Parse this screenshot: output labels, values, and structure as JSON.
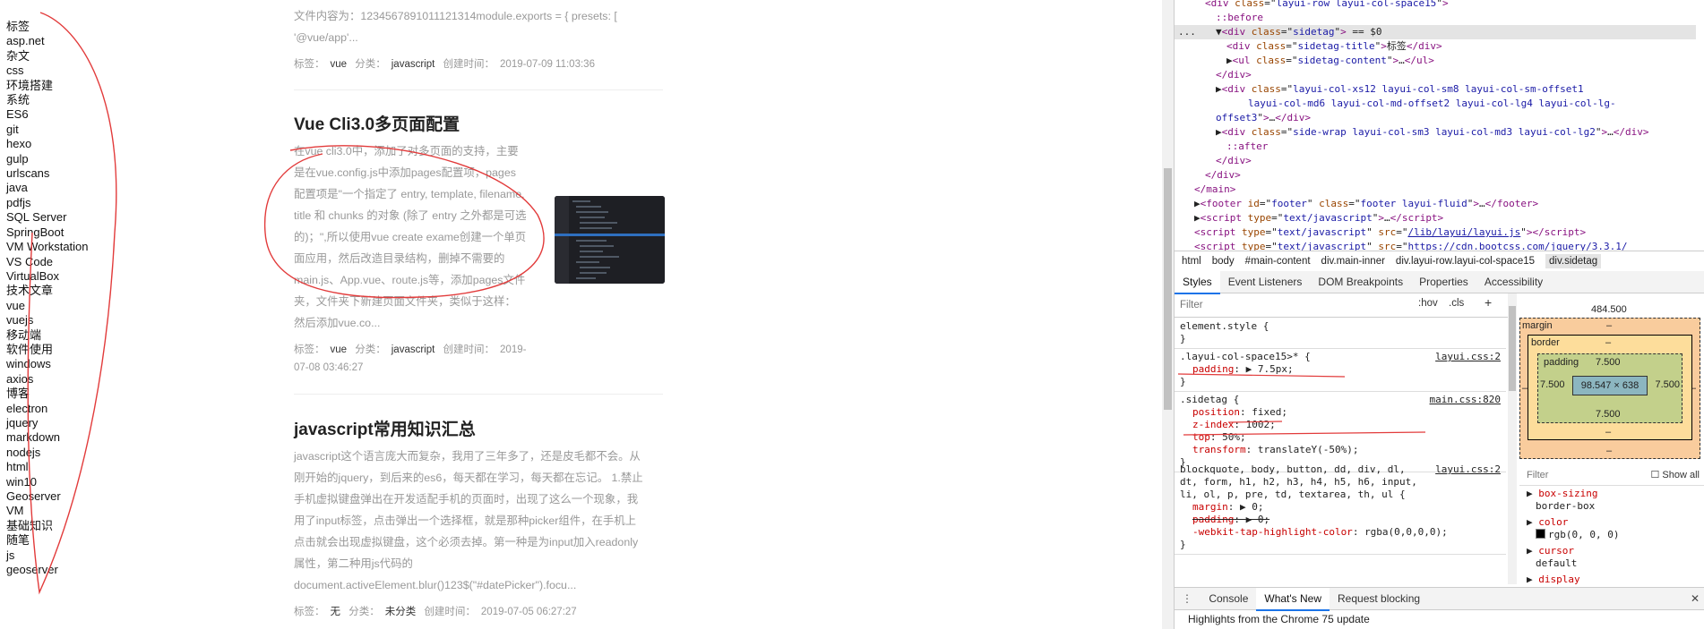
{
  "sidetag": {
    "title": "标签",
    "tags": [
      "asp.net",
      "杂文",
      "css",
      "环境搭建",
      "系统",
      "ES6",
      "git",
      "hexo",
      "gulp",
      "urlscans",
      "java",
      "pdfjs",
      "SQL Server",
      "SpringBoot",
      "VM Workstation",
      "VS Code",
      "VirtualBox",
      "技术文章",
      "vue",
      "vuejs",
      "移动端",
      "软件使用",
      "windows",
      "axios",
      "博客",
      "electron",
      "jquery",
      "markdown",
      "nodejs",
      "html",
      "win10",
      "Geoserver",
      "VM",
      "基础知识",
      "随笔",
      "js",
      "geoserver"
    ]
  },
  "articles": [
    {
      "title": "",
      "lines": [
        "文件内容为：1234567891011121314module.exports = { presets: [",
        "'@vue/app'..."
      ],
      "tag_label": "标签：",
      "tag": "vue",
      "cat_label": "分类：",
      "category": "javascript",
      "time_label": "创建时间：",
      "time": "2019-07-09 11:03:36"
    },
    {
      "title": "Vue Cli3.0多页面配置",
      "lines": [
        "在vue cli3.0中，添加了对多页面的支持，主要",
        "是在vue.config.js中添加pages配置项，pages",
        "配置项是\"一个指定了 entry, template, filename,",
        "title 和 chunks 的对象 (除了 entry 之外都是可选",
        "的)；\",所以使用vue create exame创建一个单页",
        "面应用，然后改造目录结构，删掉不需要的",
        "main.js、App.vue、route.js等，添加pages文件",
        "夹，文件夹下新建页面文件夹，类似于这样：",
        "然后添加vue.co..."
      ],
      "tag_label": "标签：",
      "tag": "vue",
      "cat_label": "分类：",
      "category": "javascript",
      "time_label": "创建时间：",
      "time": "2019-",
      "time2": "07-08 03:46:27"
    },
    {
      "title": "javascript常用知识汇总",
      "lines": [
        "javascript这个语言庞大而复杂，我用了三年多了，还是皮毛都不会。从",
        "刚开始的jquery，到后来的es6，每天都在学习，每天都在忘记。 1.禁止",
        "手机虚拟键盘弹出在开发适配手机的页面时，出现了这么一个现象，我",
        "用了input标签，点击弹出一个选择框，就是那种picker组件，在手机上",
        "点击就会出现虚拟键盘，这个必须去掉。第一种是为input加入readonly",
        "属性，第二种用js代码的",
        "document.activeElement.blur()123$(\"#datePicker\").focu..."
      ],
      "tag_label": "标签：",
      "tag": "无",
      "cat_label": "分类：",
      "category": "未分类",
      "time_label": "创建时间：",
      "time": "2019-07-05 06:27:27"
    }
  ],
  "devtools": {
    "dom": [
      {
        "indent": 0,
        "html": "<span class='tagc'>&lt;div</span> <span class='attr'>class</span>=\"<span class='aval'>layui-row layui-col-space15</span>\"<span class='tagc'>&gt;</span>"
      },
      {
        "indent": 1,
        "html": "<span class='pseudo'>::before</span>"
      },
      {
        "indent": 1,
        "html": "▼<span class='tagc'>&lt;div</span> <span class='attr'>class</span>=\"<span class='aval'>sidetag</span>\"<span class='tagc'>&gt;</span> == $0"
      },
      {
        "indent": 2,
        "html": "<span class='tagc'>&lt;div</span> <span class='attr'>class</span>=\"<span class='aval'>sidetag-title</span>\"<span class='tagc'>&gt;</span>标签<span class='tagc'>&lt;/div&gt;</span>"
      },
      {
        "indent": 2,
        "html": "▶<span class='tagc'>&lt;ul</span> <span class='attr'>class</span>=\"<span class='aval'>sidetag-content</span>\"<span class='tagc'>&gt;</span>…<span class='tagc'>&lt;/ul&gt;</span>"
      },
      {
        "indent": 1,
        "html": "<span class='tagc'>&lt;/div&gt;</span>"
      },
      {
        "indent": 1,
        "html": "▶<span class='tagc'>&lt;div</span> <span class='attr'>class</span>=\"<span class='aval'>layui-col-xs12 layui-col-sm8 layui-col-sm-offset1</span>"
      },
      {
        "indent": 4,
        "html": "<span class='aval'>layui-col-md6 layui-col-md-offset2 layui-col-lg4 layui-col-lg-</span>"
      },
      {
        "indent": 1,
        "html": "<span class='aval'>offset3</span>\"<span class='tagc'>&gt;</span>…<span class='tagc'>&lt;/div&gt;</span>"
      },
      {
        "indent": 1,
        "html": "▶<span class='tagc'>&lt;div</span> <span class='attr'>class</span>=\"<span class='aval'>side-wrap layui-col-sm3 layui-col-md3 layui-col-lg2</span>\"<span class='tagc'>&gt;</span>…<span class='tagc'>&lt;/div&gt;</span>"
      },
      {
        "indent": 2,
        "html": "<span class='pseudo'>::after</span>"
      },
      {
        "indent": 1,
        "html": "<span class='tagc'>&lt;/div&gt;</span>"
      },
      {
        "indent": 0,
        "html": "<span class='tagc'>&lt;/div&gt;</span>"
      },
      {
        "indent": -1,
        "html": "<span class='tagc'>&lt;/main&gt;</span>"
      },
      {
        "indent": -1,
        "html": "▶<span class='tagc'>&lt;footer</span> <span class='attr'>id</span>=\"<span class='aval'>footer</span>\" <span class='attr'>class</span>=\"<span class='aval'>footer layui-fluid</span>\"<span class='tagc'>&gt;</span>…<span class='tagc'>&lt;/footer&gt;</span>"
      },
      {
        "indent": -1,
        "html": "▶<span class='tagc'>&lt;script</span> <span class='attr'>type</span>=\"<span class='aval'>text/javascript</span>\"<span class='tagc'>&gt;</span>…<span class='tagc'>&lt;/script&gt;</span>"
      },
      {
        "indent": -1,
        "html": "<span class='tagc'>&lt;script</span> <span class='attr'>type</span>=\"<span class='aval'>text/javascript</span>\" <span class='attr'>src</span>=\"<span class='aval' style='text-decoration:underline'>/lib/layui/layui.js</span>\"<span class='tagc'>&gt;&lt;/script&gt;</span>"
      },
      {
        "indent": -1,
        "html": "<span class='tagc'>&lt;script</span> <span class='attr'>type</span>=\"<span class='aval'>text/javascript</span>\" <span class='attr'>src</span>=\"<span class='aval' style='text-decoration:underline'>https://cdn.bootcss.com/jquery/3.3.1/</span>"
      }
    ],
    "breadcrumb": [
      "html",
      "body",
      "#main-content",
      "div.main-inner",
      "div.layui-row.layui-col-space15",
      "div.sidetag"
    ],
    "tabs": [
      "Styles",
      "Event Listeners",
      "DOM Breakpoints",
      "Properties",
      "Accessibility"
    ],
    "filter_placeholder": "Filter",
    "hov": ":hov",
    "cls": ".cls",
    "plus": "+",
    "rules": [
      {
        "selector": "element.style {",
        "src": "",
        "props": [],
        "close": "}"
      },
      {
        "selector": ".layui-col-space15>* {",
        "src": "layui.css:2",
        "props": [
          {
            "name": "padding",
            "value": "▶ 7.5px;",
            "struck": false
          }
        ],
        "close": "}"
      },
      {
        "selector": ".sidetag {",
        "src": "main.css:820",
        "props": [
          {
            "name": "position",
            "value": "fixed;",
            "struck": false
          },
          {
            "name": "z-index",
            "value": "1002;",
            "struck": false
          },
          {
            "name": "top",
            "value": "50%;",
            "struck": false
          },
          {
            "name": "transform",
            "value": "translateY(-50%);",
            "struck": false
          }
        ],
        "close": "}"
      },
      {
        "selector": "blockquote, body, button, dd, div, dl, dt, form, h1, h2, h3, h4, h5, h6, input, li, ol, p, pre, td, textarea, th, ul {",
        "src": "layui.css:2",
        "props": [
          {
            "name": "margin",
            "value": "▶ 0;",
            "struck": false
          },
          {
            "name": "padding",
            "value": "▶ 0;",
            "struck": true
          },
          {
            "name": "-webkit-tap-highlight-color",
            "value": "rgba(0,0,0,0);",
            "struck": false
          }
        ],
        "close": "}"
      }
    ],
    "boxmodel": {
      "width_label": "484.500",
      "margin_label": "margin",
      "margin_val": "–",
      "border_label": "border",
      "border_val": "–",
      "padding_label": "padding",
      "padding_val": "7.500",
      "left": "7.500",
      "right": "7.500",
      "bottom": "7.500",
      "content": "98.547 × 638",
      "mleft": "–",
      "mright": "–",
      "mbottom": "–",
      "bbottom": "–"
    },
    "computed_filter": "Filter",
    "show_all": "Show all",
    "computed": [
      {
        "name": "box-sizing",
        "value": "border-box"
      },
      {
        "name": "color",
        "value": "rgb(0, 0, 0)",
        "swatch": "#000000"
      },
      {
        "name": "cursor",
        "value": "default"
      },
      {
        "name": "display",
        "value": ""
      }
    ],
    "drawer_tabs": [
      "Console",
      "What's New",
      "Request blocking"
    ],
    "drawer_body": "Highlights from the Chrome 75 update"
  }
}
